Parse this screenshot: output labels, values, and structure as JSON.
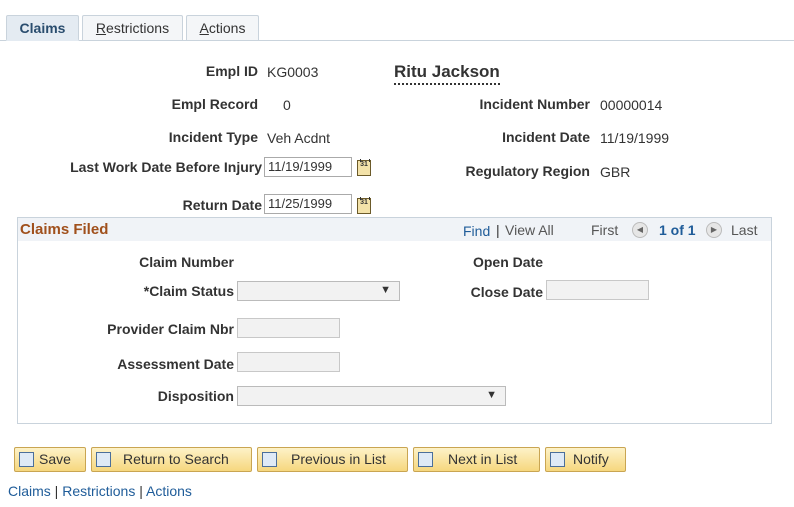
{
  "tabs": [
    {
      "label": "Claims"
    },
    {
      "label_first": "R",
      "label_rest": "estrictions"
    },
    {
      "label_first": "A",
      "label_rest": "ctions"
    }
  ],
  "header": {
    "empl_id_label": "Empl ID",
    "empl_id": "KG0003",
    "employee_name": "Ritu Jackson",
    "empl_record_label": "Empl Record",
    "empl_record": "0",
    "incident_number_label": "Incident Number",
    "incident_number": "00000014",
    "incident_type_label": "Incident Type",
    "incident_type": "Veh Acdnt",
    "incident_date_label": "Incident Date",
    "incident_date": "11/19/1999",
    "last_work_date_label": "Last Work Date Before Injury",
    "last_work_date": "11/19/1999",
    "regulatory_region_label": "Regulatory Region",
    "regulatory_region": "GBR",
    "return_date_label": "Return Date",
    "return_date": "11/25/1999",
    "calendar_icon_text": "31"
  },
  "claims_filed": {
    "title": "Claims Filed",
    "find": "Find",
    "separator": "|",
    "view_all": "View All",
    "first": "First",
    "page_indicator": "1 of 1",
    "last": "Last",
    "claim_number_label": "Claim Number",
    "open_date_label": "Open Date",
    "claim_status_label": "*Claim Status",
    "claim_status_value": "",
    "close_date_label": "Close Date",
    "close_date_value": "",
    "provider_claim_label": "Provider Claim Nbr",
    "provider_claim_value": "",
    "assessment_date_label": "Assessment Date",
    "assessment_date_value": "",
    "disposition_label": "Disposition",
    "disposition_value": ""
  },
  "buttons": {
    "save": "Save",
    "return_to_search": "Return to Search",
    "previous_in_list": "Previous in List",
    "next_in_list": "Next in List",
    "notify": "Notify"
  },
  "footer": {
    "claims": "Claims",
    "restrictions": "Restrictions",
    "actions": "Actions",
    "separator": "|"
  },
  "icons": {
    "calendar": "calendar-icon",
    "save": "save-icon",
    "search": "return-to-search-icon",
    "previous": "previous-in-list-icon",
    "next": "next-in-list-icon",
    "notify": "notify-icon"
  }
}
